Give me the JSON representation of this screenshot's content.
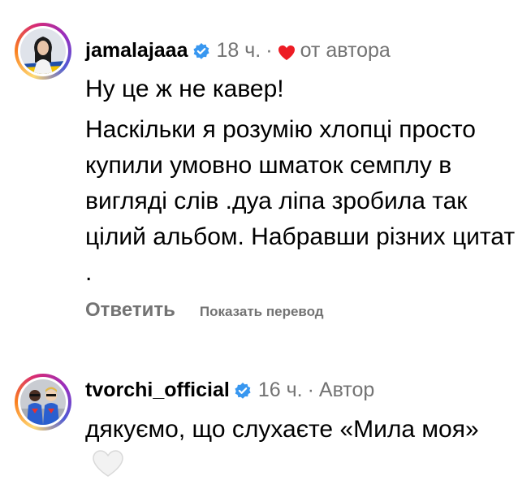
{
  "comments": [
    {
      "username": "jamalajaaa",
      "time": "18 ч.",
      "separator": "·",
      "author_like_label": "от автора",
      "paragraphs": [
        "Ну це ж не кавер!",
        "Наскільки я розумію хлопці просто купили умовно шматок семплу в вигляді слів .дуа ліпа зробила так цілий альбом. Набравши різних цитат ."
      ],
      "reply_label": "Ответить",
      "translate_label": "Показать перевод"
    },
    {
      "username": "tvorchi_official",
      "time": "16 ч.",
      "separator": "·",
      "author_label": "Автор",
      "text": "дякуємо, що слухаєте «Мила моя»"
    }
  ],
  "colors": {
    "verified_blue": "#3897f0",
    "heart_red": "#ed1c24",
    "meta_gray": "#737373"
  },
  "icons": {
    "verified": "verified-badge-icon",
    "heart": "heart-icon",
    "white_heart_emoji": "white-heart-emoji-icon"
  }
}
